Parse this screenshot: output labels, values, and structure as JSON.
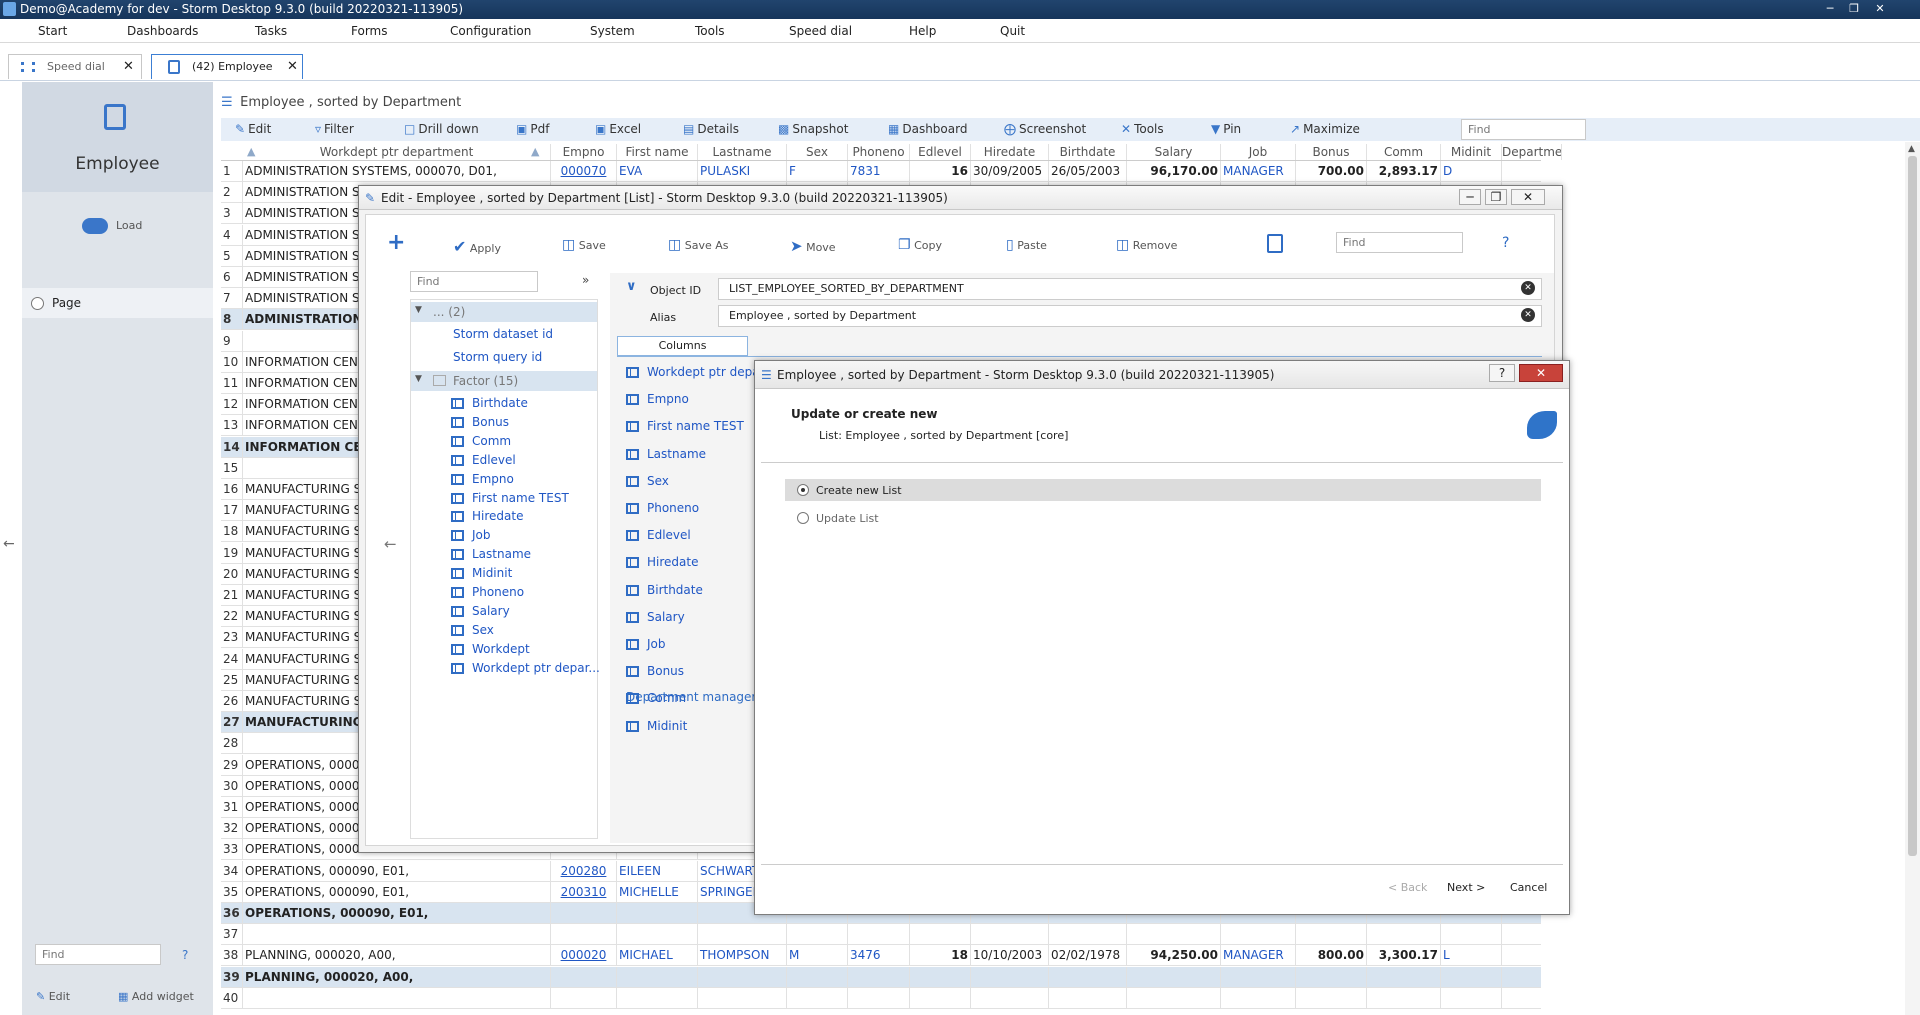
{
  "window": {
    "title": "Demo@Academy for dev -  Storm Desktop 9.3.0 (build 20220321-113905)"
  },
  "menu": [
    "Start",
    "Dashboards",
    "Tasks",
    "Forms",
    "Configuration",
    "System",
    "Tools",
    "Speed dial",
    "Help",
    "Quit"
  ],
  "tabs": [
    {
      "label": "Speed dial"
    },
    {
      "label": "(42) Employee"
    }
  ],
  "left": {
    "title": "Employee",
    "load": "Load",
    "page": "Page",
    "find_placeholder": "Find",
    "help": "?",
    "edit": "Edit",
    "add_widget": "Add widget"
  },
  "page": {
    "title": "Employee , sorted by Department",
    "find_placeholder": "Find"
  },
  "toolbar": [
    "Edit",
    "Filter",
    "Drill down",
    "Pdf",
    "Excel",
    "Details",
    "Snapshot",
    "Dashboard",
    "Screenshot",
    "Tools",
    "Pin",
    "Maximize"
  ],
  "columns": [
    "Workdept ptr department",
    "Empno",
    "First name",
    "Lastname",
    "Sex",
    "Phoneno",
    "Edlevel",
    "Hiredate",
    "Birthdate",
    "Salary",
    "Job",
    "Bonus",
    "Comm",
    "Midinit",
    "Departme"
  ],
  "rows": [
    {
      "n": "1",
      "dept": "ADMINISTRATION SYSTEMS, 000070, D01,",
      "empno": "000070",
      "first": "EVA",
      "last": "PULASKI",
      "sex": "F",
      "phone": "7831",
      "ed": "16",
      "hire": "30/09/2005",
      "birth": "26/05/2003",
      "salary": "96,170.00",
      "job": "MANAGER",
      "bonus": "700.00",
      "comm": "2,893.17",
      "mid": "D"
    },
    {
      "n": "2",
      "dept": "ADMINISTRATION S"
    },
    {
      "n": "3",
      "dept": "ADMINISTRATION S"
    },
    {
      "n": "4",
      "dept": "ADMINISTRATION S"
    },
    {
      "n": "5",
      "dept": "ADMINISTRATION S"
    },
    {
      "n": "6",
      "dept": "ADMINISTRATION S"
    },
    {
      "n": "7",
      "dept": "ADMINISTRATION S"
    },
    {
      "n": "8",
      "dept": "ADMINISTRATION S",
      "grp": true
    },
    {
      "n": "9",
      "dept": ""
    },
    {
      "n": "10",
      "dept": "INFORMATION CEN"
    },
    {
      "n": "11",
      "dept": "INFORMATION CEN"
    },
    {
      "n": "12",
      "dept": "INFORMATION CEN"
    },
    {
      "n": "13",
      "dept": "INFORMATION CEN"
    },
    {
      "n": "14",
      "dept": "INFORMATION CEN",
      "grp": true
    },
    {
      "n": "15",
      "dept": ""
    },
    {
      "n": "16",
      "dept": "MANUFACTURING S"
    },
    {
      "n": "17",
      "dept": "MANUFACTURING S"
    },
    {
      "n": "18",
      "dept": "MANUFACTURING S"
    },
    {
      "n": "19",
      "dept": "MANUFACTURING S"
    },
    {
      "n": "20",
      "dept": "MANUFACTURING S"
    },
    {
      "n": "21",
      "dept": "MANUFACTURING S"
    },
    {
      "n": "22",
      "dept": "MANUFACTURING S"
    },
    {
      "n": "23",
      "dept": "MANUFACTURING S"
    },
    {
      "n": "24",
      "dept": "MANUFACTURING S"
    },
    {
      "n": "25",
      "dept": "MANUFACTURING S"
    },
    {
      "n": "26",
      "dept": "MANUFACTURING S"
    },
    {
      "n": "27",
      "dept": "MANUFACTURING",
      "grp": true
    },
    {
      "n": "28",
      "dept": ""
    },
    {
      "n": "29",
      "dept": "OPERATIONS, 00009"
    },
    {
      "n": "30",
      "dept": "OPERATIONS, 00009"
    },
    {
      "n": "31",
      "dept": "OPERATIONS, 00009"
    },
    {
      "n": "32",
      "dept": "OPERATIONS, 00009"
    },
    {
      "n": "33",
      "dept": "OPERATIONS, 00009"
    },
    {
      "n": "34",
      "dept": "OPERATIONS, 000090, E01,",
      "empno": "200280",
      "first": "EILEEN",
      "last": "SCHWARTZ"
    },
    {
      "n": "35",
      "dept": "OPERATIONS, 000090, E01,",
      "empno": "200310",
      "first": "MICHELLE",
      "last": "SPRINGER"
    },
    {
      "n": "36",
      "dept": "OPERATIONS, 000090, E01,",
      "grp": true
    },
    {
      "n": "37",
      "dept": ""
    },
    {
      "n": "38",
      "dept": "PLANNING, 000020, A00,",
      "empno": "000020",
      "first": "MICHAEL",
      "last": "THOMPSON",
      "sex": "M",
      "phone": "3476",
      "ed": "18",
      "hire": "10/10/2003",
      "birth": "02/02/1978",
      "salary": "94,250.00",
      "job": "MANAGER",
      "bonus": "800.00",
      "comm": "3,300.17",
      "mid": "L"
    },
    {
      "n": "39",
      "dept": "PLANNING, 000020, A00,",
      "grp": true
    },
    {
      "n": "40",
      "dept": ""
    }
  ],
  "edit_dialog": {
    "title": "Edit - Employee , sorted by Department [List] -  Storm Desktop 9.3.0 (build 20220321-113905)",
    "toolbar": [
      "Apply",
      "Save",
      "Save As",
      "Move",
      "Copy",
      "Paste",
      "Remove"
    ],
    "find_placeholder": "Find",
    "help": "?",
    "expand": "»",
    "tree_root": "... (2)",
    "tree_storm": [
      "Storm dataset id",
      "Storm query id"
    ],
    "factor_label": "Factor (15)",
    "factors": [
      "Birthdate",
      "Bonus",
      "Comm",
      "Edlevel",
      "Empno",
      "First name TEST",
      "Hiredate",
      "Job",
      "Lastname",
      "Midinit",
      "Phoneno",
      "Salary",
      "Sex",
      "Workdept",
      "Workdept ptr depar..."
    ],
    "object_id_label": "Object ID",
    "object_id": "LIST_EMPLOYEE_SORTED_BY_DEPARTMENT",
    "alias_label": "Alias",
    "alias": "Employee , sorted by Department",
    "columns_tab": "Columns",
    "columns": [
      "Workdept ptr departm",
      "Empno",
      "First name TEST",
      "Lastname",
      "Sex",
      "Phoneno",
      "Edlevel",
      "Hiredate",
      "Birthdate",
      "Salary",
      "Job",
      "Bonus",
      "Comm",
      "Midinit"
    ],
    "dept_manager": "Department manager"
  },
  "wizard": {
    "title": "Employee , sorted by Department -  Storm Desktop 9.3.0 (build 20220321-113905)",
    "heading": "Update or create new",
    "subheading": "List: Employee , sorted by Department [core]",
    "options": [
      "Create new List",
      "Update List"
    ],
    "selected": 0,
    "back": "< Back",
    "next": "Next >",
    "cancel": "Cancel",
    "help": "?"
  },
  "colors": {
    "accent": "#1f56c4",
    "title": "#16355b",
    "group_row": "#d8e4f0"
  }
}
